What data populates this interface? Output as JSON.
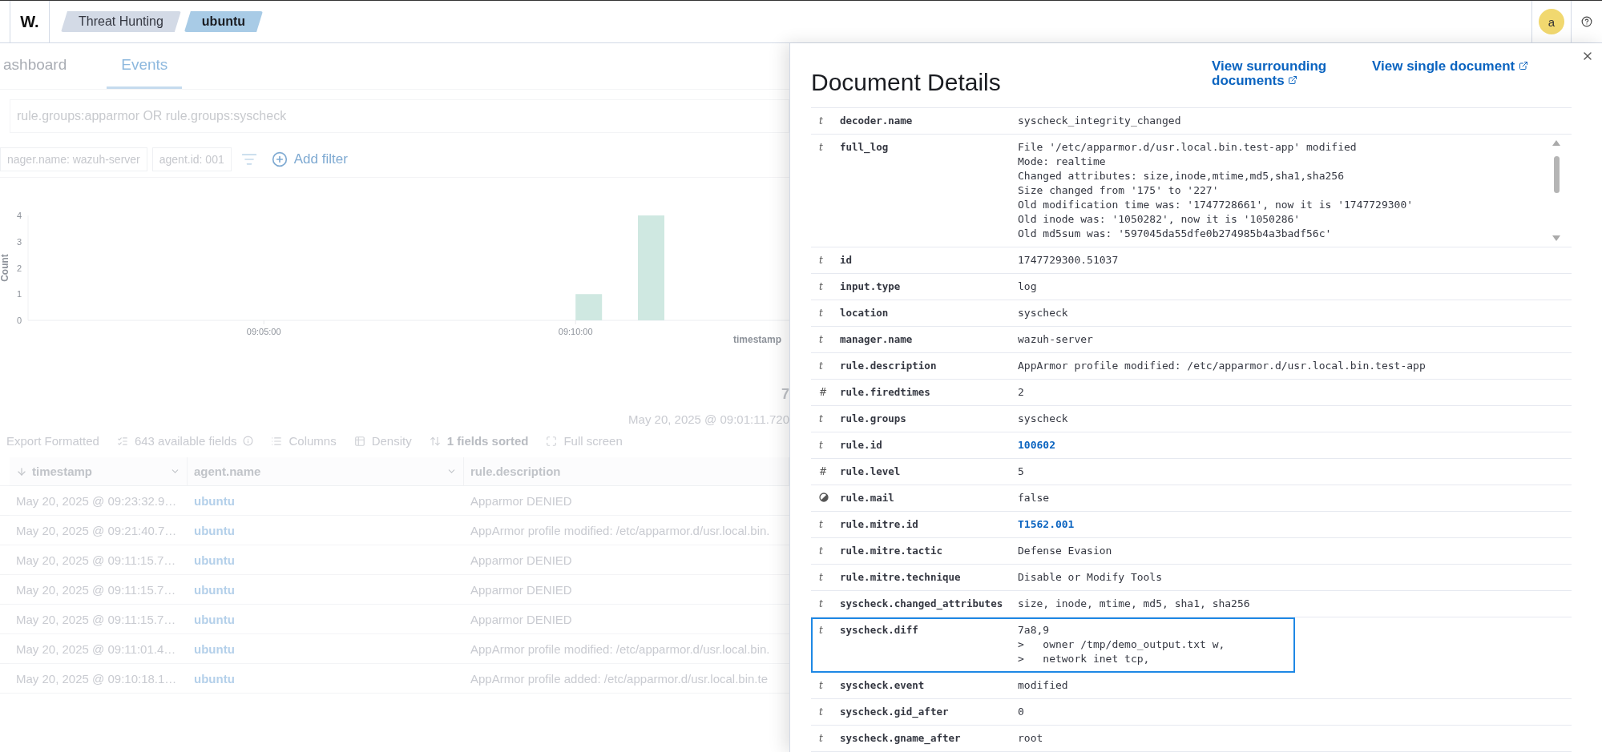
{
  "header": {
    "logo": "W.",
    "breadcrumbs": [
      {
        "label": "Threat Hunting",
        "selected": false
      },
      {
        "label": "ubuntu",
        "selected": true
      }
    ],
    "avatar": "a"
  },
  "tabs": [
    {
      "label": "ashboard",
      "selected": false
    },
    {
      "label": "Events",
      "selected": true
    }
  ],
  "query": "rule.groups:apparmor OR rule.groups:syscheck",
  "filters": [
    "nager.name: wazuh-server",
    "agent.id: 001"
  ],
  "add_filter": "Add filter",
  "histogram": {
    "chart_data": {
      "type": "bar",
      "xlabel": "timestamp",
      "ylabel": "Count",
      "categories": [
        null,
        null,
        null,
        null,
        null,
        null,
        null,
        null,
        "09:05:00",
        null,
        null,
        null,
        null,
        null,
        null,
        null,
        null,
        null,
        "09:10:00",
        null,
        null,
        null,
        null,
        null,
        null,
        null
      ],
      "values": [
        0,
        0,
        0,
        0,
        0,
        0,
        0,
        0,
        0,
        0,
        0,
        0,
        0,
        0,
        0,
        0,
        0,
        0,
        1,
        0,
        4,
        0,
        0,
        0,
        0,
        0
      ],
      "ylim": [
        0,
        4
      ],
      "yticks": [
        0,
        1,
        2,
        3,
        4
      ]
    }
  },
  "hits": {
    "count": "7",
    "range": "May 20, 2025 @ 09:01:11.720"
  },
  "toolbar": [
    {
      "kind": "export",
      "label": "Export Formatted"
    },
    {
      "kind": "fields",
      "label": "643 available fields"
    },
    {
      "kind": "columns",
      "label": "Columns"
    },
    {
      "kind": "density",
      "label": "Density"
    },
    {
      "kind": "sort",
      "label": "1 fields sorted"
    },
    {
      "kind": "fullscreen",
      "label": "Full screen"
    }
  ],
  "table": {
    "columns": [
      "timestamp",
      "agent.name",
      "rule.description"
    ],
    "rows": [
      {
        "timestamp": "May 20, 2025 @ 09:23:32.9…",
        "agent": "ubuntu",
        "description": "Apparmor DENIED"
      },
      {
        "timestamp": "May 20, 2025 @ 09:21:40.7…",
        "agent": "ubuntu",
        "description": "AppArmor profile modified: /etc/apparmor.d/usr.local.bin."
      },
      {
        "timestamp": "May 20, 2025 @ 09:11:15.7…",
        "agent": "ubuntu",
        "description": "Apparmor DENIED"
      },
      {
        "timestamp": "May 20, 2025 @ 09:11:15.7…",
        "agent": "ubuntu",
        "description": "Apparmor DENIED"
      },
      {
        "timestamp": "May 20, 2025 @ 09:11:15.7…",
        "agent": "ubuntu",
        "description": "Apparmor DENIED"
      },
      {
        "timestamp": "May 20, 2025 @ 09:11:01.4…",
        "agent": "ubuntu",
        "description": "AppArmor profile modified: /etc/apparmor.d/usr.local.bin."
      },
      {
        "timestamp": "May 20, 2025 @ 09:10:18.1…",
        "agent": "ubuntu",
        "description": "AppArmor profile added: /etc/apparmor.d/usr.local.bin.te"
      }
    ]
  },
  "flyout": {
    "title": "Document Details",
    "links": [
      "View surrounding documents",
      "View single document"
    ],
    "fields": [
      {
        "kind": "text",
        "glyph": "t",
        "key": "decoder.name",
        "value": "syscheck_integrity_changed",
        "link": false,
        "highlighted": false
      },
      {
        "kind": "text",
        "glyph": "t",
        "key": "full_log",
        "value": "File '/etc/apparmor.d/usr.local.bin.test-app' modified\nMode: realtime\nChanged attributes: size,inode,mtime,md5,sha1,sha256\nSize changed from '175' to '227'\nOld modification time was: '1747728661', now it is '1747729300'\nOld inode was: '1050282', now it is '1050286'\nOld md5sum was: '597045da55dfe0b274985b4a3badf56c'",
        "link": false,
        "highlighted": false
      },
      {
        "kind": "text",
        "glyph": "t",
        "key": "id",
        "value": "1747729300.51037",
        "link": false,
        "highlighted": false
      },
      {
        "kind": "text",
        "glyph": "t",
        "key": "input.type",
        "value": "log",
        "link": false,
        "highlighted": false
      },
      {
        "kind": "text",
        "glyph": "t",
        "key": "location",
        "value": "syscheck",
        "link": false,
        "highlighted": false
      },
      {
        "kind": "text",
        "glyph": "t",
        "key": "manager.name",
        "value": "wazuh-server",
        "link": false,
        "highlighted": false
      },
      {
        "kind": "text",
        "glyph": "t",
        "key": "rule.description",
        "value": "AppArmor profile modified: /etc/apparmor.d/usr.local.bin.test-app",
        "link": false,
        "highlighted": false
      },
      {
        "kind": "number",
        "glyph": "#",
        "key": "rule.firedtimes",
        "value": "2",
        "link": false,
        "highlighted": false
      },
      {
        "kind": "text",
        "glyph": "t",
        "key": "rule.groups",
        "value": "syscheck",
        "link": false,
        "highlighted": false
      },
      {
        "kind": "text",
        "glyph": "t",
        "key": "rule.id",
        "value": "100602",
        "link": true,
        "highlighted": false
      },
      {
        "kind": "number",
        "glyph": "#",
        "key": "rule.level",
        "value": "5",
        "link": false,
        "highlighted": false
      },
      {
        "kind": "boolean",
        "key": "rule.mail",
        "value": "false",
        "link": false,
        "highlighted": false
      },
      {
        "kind": "text",
        "glyph": "t",
        "key": "rule.mitre.id",
        "value": "T1562.001",
        "link": true,
        "highlighted": false
      },
      {
        "kind": "text",
        "glyph": "t",
        "key": "rule.mitre.tactic",
        "value": "Defense Evasion",
        "link": false,
        "highlighted": false
      },
      {
        "kind": "text",
        "glyph": "t",
        "key": "rule.mitre.technique",
        "value": "Disable or Modify Tools",
        "link": false,
        "highlighted": false
      },
      {
        "kind": "text",
        "glyph": "t",
        "key": "syscheck.changed_attributes",
        "value": "size, inode, mtime, md5, sha1, sha256",
        "link": false,
        "highlighted": false
      },
      {
        "kind": "text",
        "glyph": "t",
        "key": "syscheck.diff",
        "value": "7a8,9\n>   owner /tmp/demo_output.txt w,\n>   network inet tcp,",
        "link": false,
        "highlighted": true
      },
      {
        "kind": "text",
        "glyph": "t",
        "key": "syscheck.event",
        "value": "modified",
        "link": false,
        "highlighted": false
      },
      {
        "kind": "text",
        "glyph": "t",
        "key": "syscheck.gid_after",
        "value": "0",
        "link": false,
        "highlighted": false
      },
      {
        "kind": "text",
        "glyph": "t",
        "key": "syscheck.gname_after",
        "value": "root",
        "link": false,
        "highlighted": false
      }
    ]
  }
}
